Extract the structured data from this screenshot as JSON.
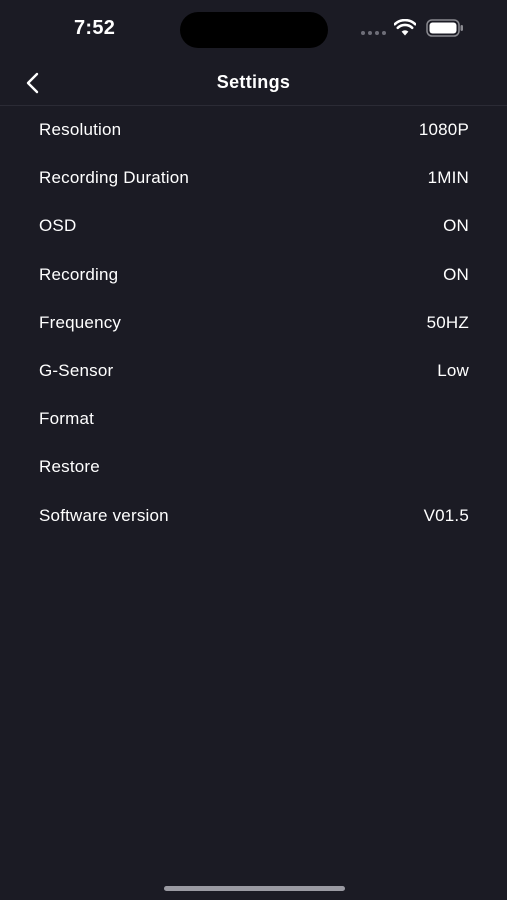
{
  "status_bar": {
    "time": "7:52"
  },
  "nav": {
    "title": "Settings",
    "back_icon": "chevron-left-icon"
  },
  "settings": [
    {
      "label": "Resolution",
      "value": "1080P"
    },
    {
      "label": "Recording Duration",
      "value": "1MIN"
    },
    {
      "label": "OSD",
      "value": "ON"
    },
    {
      "label": "Recording",
      "value": "ON"
    },
    {
      "label": "Frequency",
      "value": "50HZ"
    },
    {
      "label": "G-Sensor",
      "value": "Low"
    },
    {
      "label": "Format",
      "value": ""
    },
    {
      "label": "Restore",
      "value": ""
    },
    {
      "label": "Software version",
      "value": "V01.5"
    }
  ],
  "colors": {
    "background": "#1b1b24",
    "text": "#ffffff",
    "divider": "#2b2b35"
  }
}
